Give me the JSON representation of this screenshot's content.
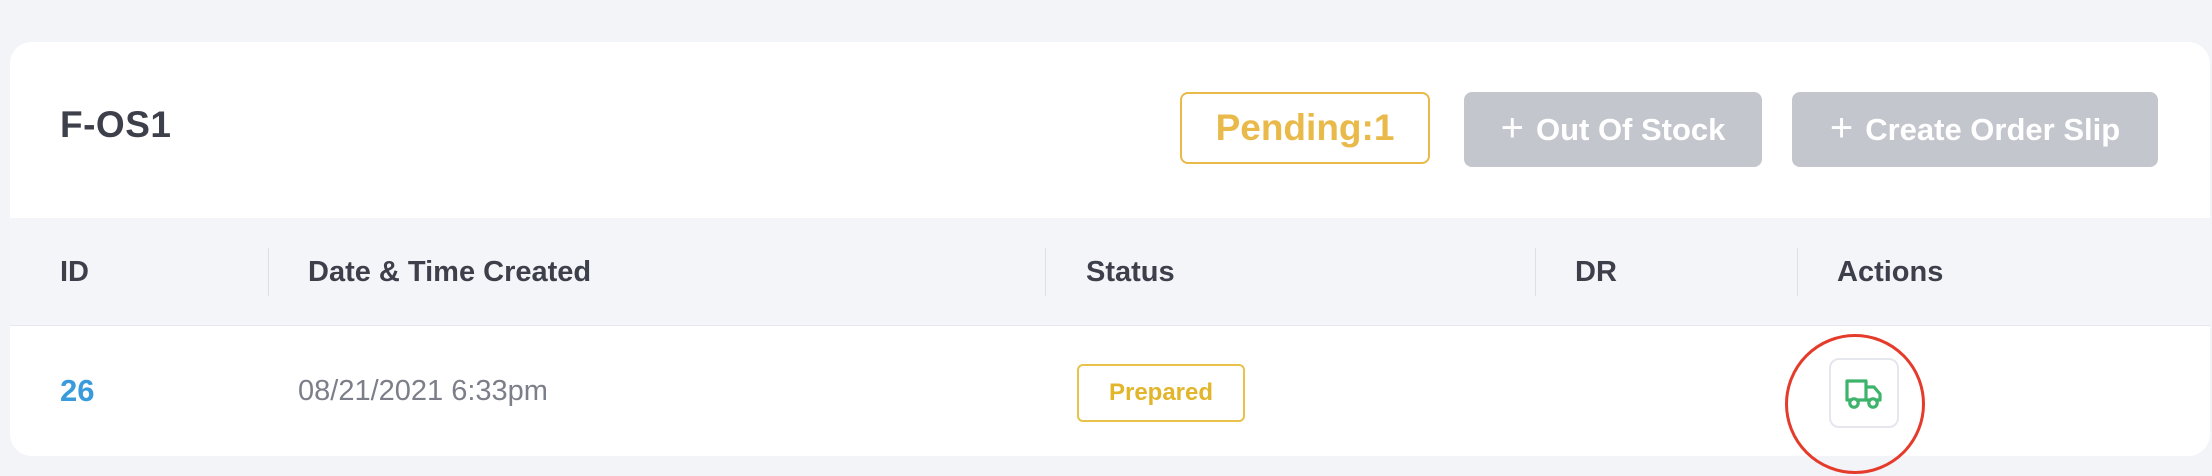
{
  "header": {
    "title": "F-OS1",
    "pending_label": "Pending:1",
    "out_of_stock_label": "Out Of Stock",
    "create_order_slip_label": "Create Order Slip",
    "plus_glyph": "+"
  },
  "table": {
    "columns": [
      "ID",
      "Date & Time Created",
      "Status",
      "DR",
      "Actions"
    ],
    "rows": [
      {
        "id": "26",
        "date_created": "08/21/2021 6:33pm",
        "status": "Prepared",
        "dr": "",
        "action_icon": "truck-icon"
      }
    ]
  },
  "colors": {
    "pending": "#e9b949",
    "button_bg": "#c3c6cd",
    "id_link": "#3a9bdc",
    "status_prepared": "#e2b52b",
    "truck_icon": "#3db36b",
    "highlight_ring": "#e53b2b"
  }
}
